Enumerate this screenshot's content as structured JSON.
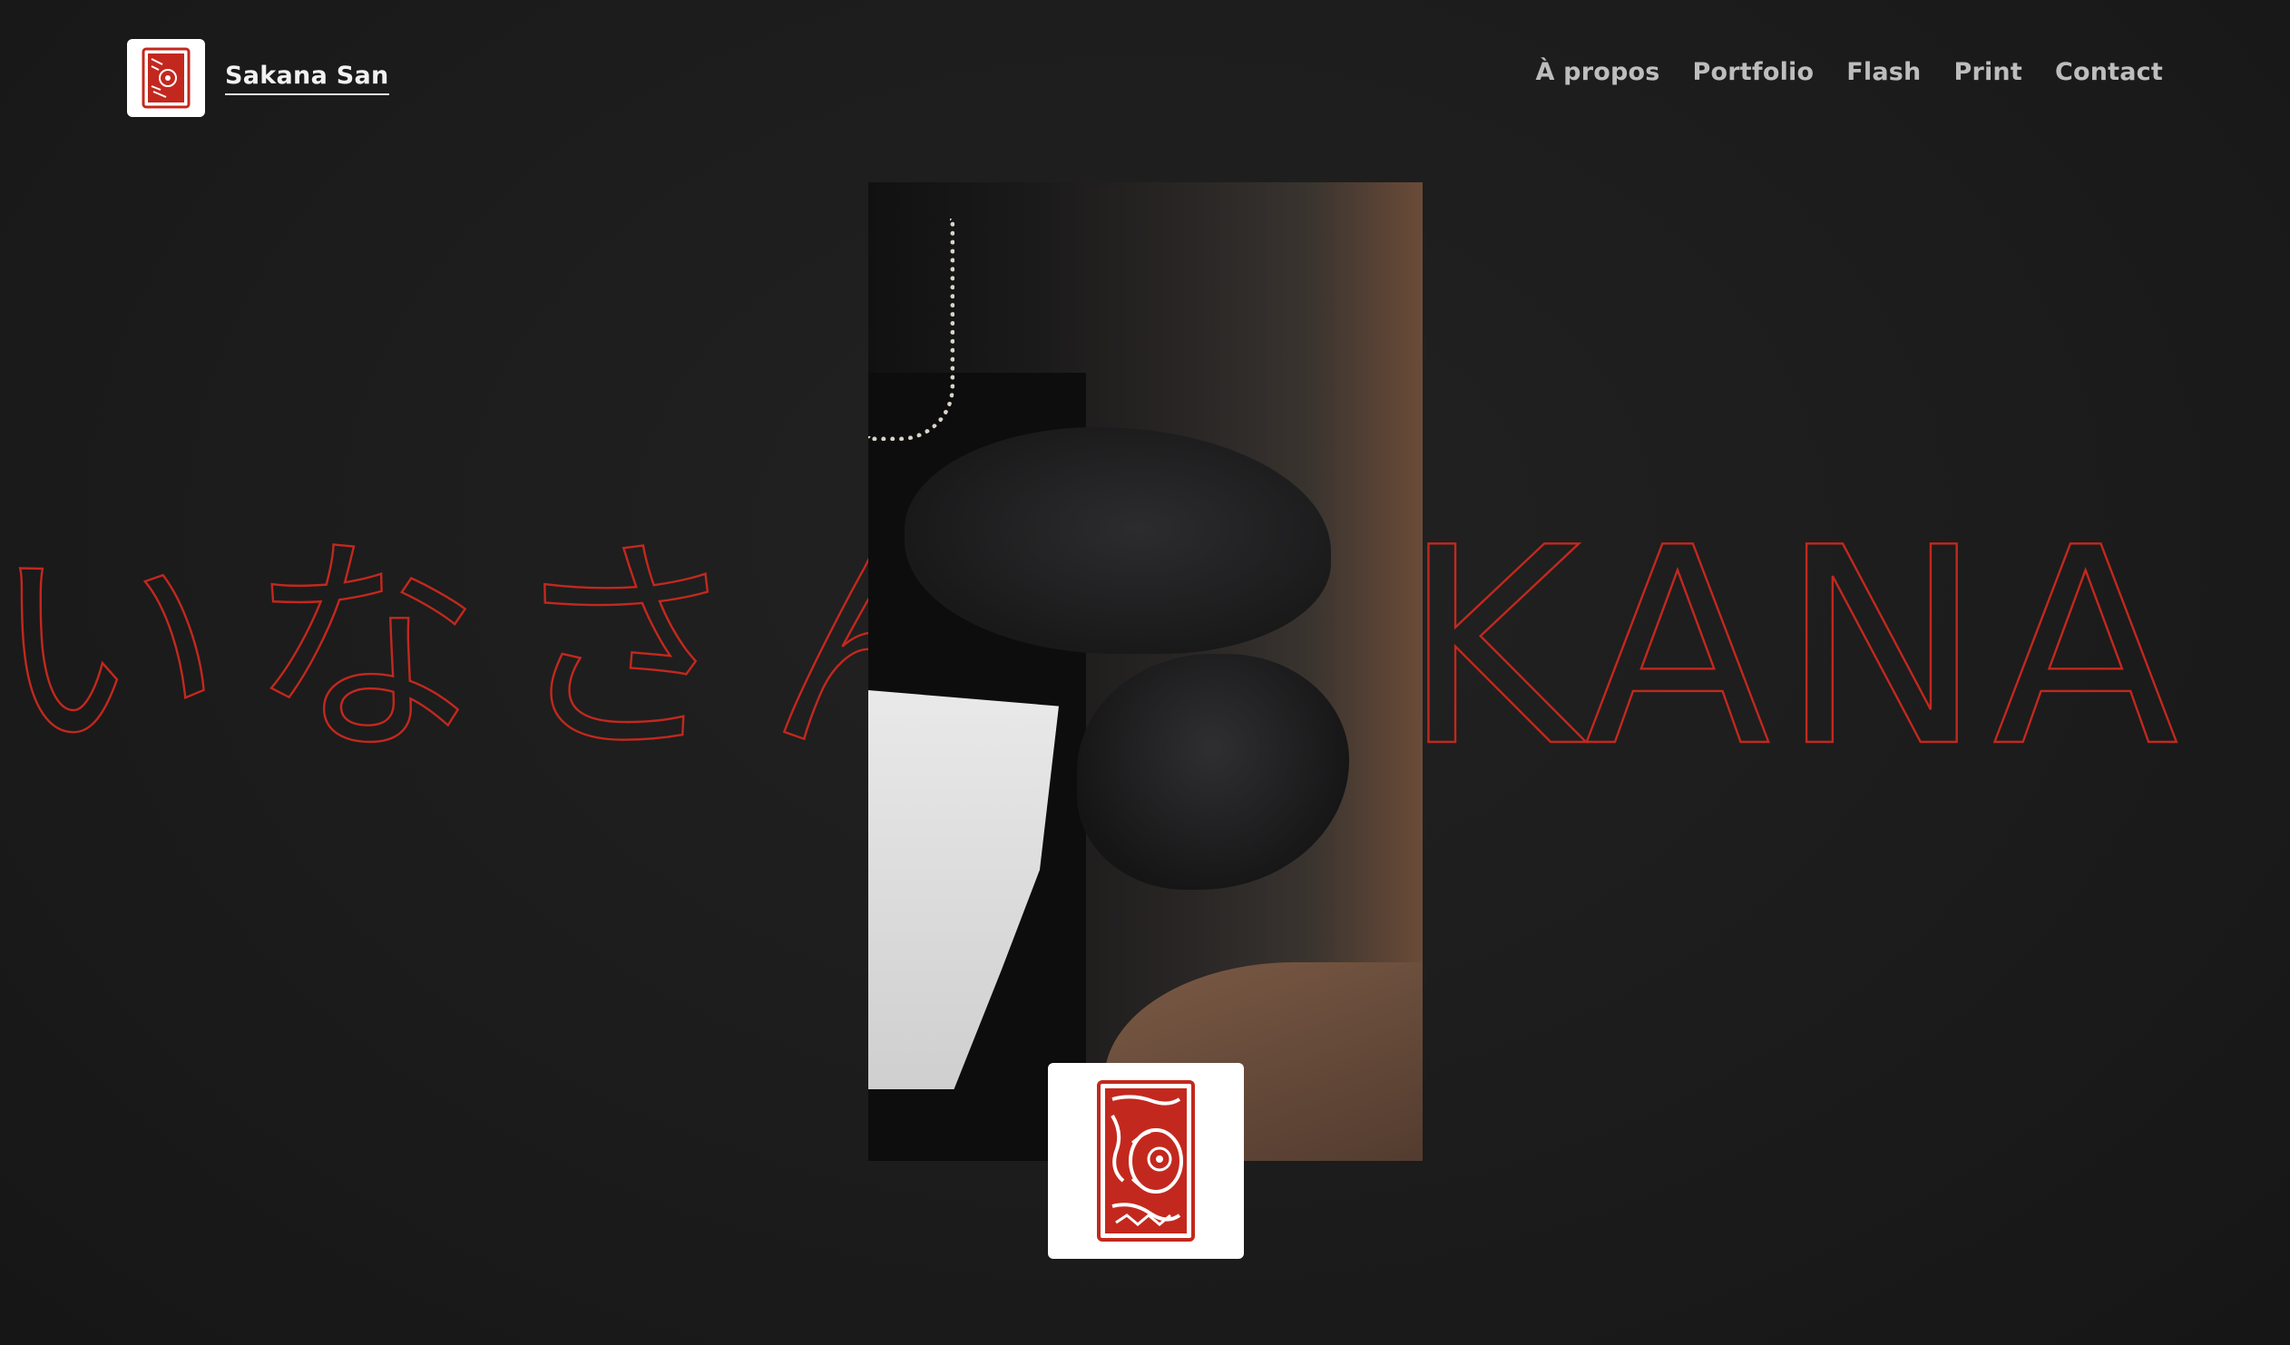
{
  "header": {
    "brand_name": "Sakana San",
    "nav": [
      {
        "label": "À propos"
      },
      {
        "label": "Portfolio"
      },
      {
        "label": "Flash"
      },
      {
        "label": "Print"
      },
      {
        "label": "Contact"
      }
    ]
  },
  "hero": {
    "outline_japanese": "いなさん",
    "outline_latin": "KANA SA"
  },
  "colors": {
    "background": "#1b1b1b",
    "accent_red": "#c3281e",
    "nav_text": "#bdbdbd"
  },
  "logo": {
    "text": "Sakana San",
    "icon": "fish-stamp-icon"
  }
}
